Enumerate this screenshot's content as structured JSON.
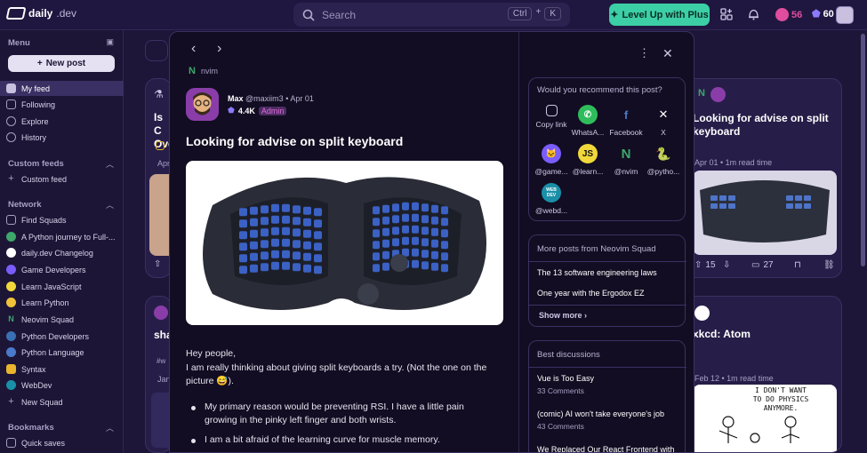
{
  "topbar": {
    "logo_text": "daily",
    "logo_suffix": ".dev",
    "search_placeholder": "Search",
    "kbd_ctrl": "Ctrl",
    "kbd_k": "K",
    "levelup_label": "Level Up with Plus",
    "streak": "56",
    "reputation": "60"
  },
  "sidebar": {
    "menu_heading": "Menu",
    "new_post": "New post",
    "menu_items": [
      {
        "label": "My feed"
      },
      {
        "label": "Following"
      },
      {
        "label": "Explore"
      },
      {
        "label": "History"
      }
    ],
    "custom_heading": "Custom feeds",
    "custom_items": [
      {
        "label": "Custom feed"
      }
    ],
    "network_heading": "Network",
    "network_items": [
      {
        "label": "Find Squads"
      },
      {
        "label": "A Python journey to Full-..."
      },
      {
        "label": "daily.dev Changelog"
      },
      {
        "label": "Game Developers"
      },
      {
        "label": "Learn JavaScript"
      },
      {
        "label": "Learn Python"
      },
      {
        "label": "Neovim Squad"
      },
      {
        "label": "Python Developers"
      },
      {
        "label": "Python Language"
      },
      {
        "label": "Syntax"
      },
      {
        "label": "WebDev"
      },
      {
        "label": "New Squad"
      }
    ],
    "bookmarks_heading": "Bookmarks",
    "bookmark_items": [
      {
        "label": "Quick saves"
      }
    ]
  },
  "feed": {
    "left_card_title": "Is C Ove",
    "left_card_meta": "Apr",
    "left_card2_title": "sha",
    "left_card2_tag": "#w",
    "left_card2_meta": "Jan",
    "right_card_title": "Looking for advise on split keyboard",
    "right_card_meta": "Apr 01 • 1m read time",
    "right_card_upvotes": "15",
    "right_card_comments": "27",
    "right_card2_title": "xkcd: Atom",
    "right_card2_meta": "Feb 12 • 1m read time",
    "right_card2_comic_text": "I DON'T WANT TO DO PHYSICS ANYMORE."
  },
  "post": {
    "squad": "nvim",
    "author_name": "Max",
    "author_handle": "@maxiim3",
    "date": "Apr 01",
    "reputation": "4.4K",
    "badge": "Admin",
    "title": "Looking for advise on split keyboard",
    "greeting": "Hey people,",
    "para1": "I am really thinking about giving split keyboards a try. (Not the one on the picture 😅).",
    "bullets": [
      "My primary reason would be preventing RSI. I have a little pain growing in the pinky left finger and both wrists.",
      "I am a bit afraid of the learning curve for muscle memory."
    ]
  },
  "share": {
    "question": "Would you recommend this post?",
    "options": [
      {
        "label": "Copy link",
        "icon": "link-icon"
      },
      {
        "label": "WhatsA...",
        "icon": "whatsapp-icon"
      },
      {
        "label": "Facebook",
        "icon": "facebook-icon"
      },
      {
        "label": "X",
        "icon": "x-icon"
      }
    ],
    "squads": [
      {
        "label": "@game...",
        "glyph": "🐱"
      },
      {
        "label": "@learn...",
        "glyph": "JS"
      },
      {
        "label": "@nvim",
        "glyph": "N"
      },
      {
        "label": "@pytho...",
        "glyph": "🐍"
      },
      {
        "label": "@webd...",
        "glyph": "WEB DEV"
      }
    ]
  },
  "more_posts": {
    "heading": "More posts from Neovim Squad",
    "items": [
      "The 13 software engineering laws",
      "One year with the Ergodox EZ"
    ],
    "show_more": "Show more"
  },
  "discussions": {
    "heading": "Best discussions",
    "items": [
      {
        "title": "Vue is Too Easy",
        "comments": "33 Comments"
      },
      {
        "title": "(comic) AI won't take everyone's job",
        "comments": "43 Comments"
      },
      {
        "title": "We Replaced Our React Frontend with",
        "comments": ""
      }
    ]
  },
  "colors": {
    "accent": "#3ccfa5",
    "admin": "#e06ad8",
    "bg": "#1e1638"
  }
}
